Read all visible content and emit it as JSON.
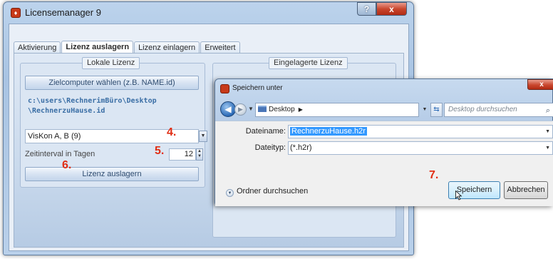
{
  "main_window": {
    "title": "Licensemanager 9",
    "help_button": "?",
    "close_button": "x",
    "tabs": [
      {
        "label": "Aktivierung",
        "active": false
      },
      {
        "label": "Lizenz auslagern",
        "active": true
      },
      {
        "label": "Lizenz einlagern",
        "active": false
      },
      {
        "label": "Erweitert",
        "active": false
      }
    ],
    "local_group": {
      "title": "Lokale Lizenz",
      "choose_computer_button": "Zielcomputer wählen (z.B. NAME.id)",
      "path_line1": "c:\\users\\RechnerimBüro\\Desktop",
      "path_line2": "\\RechnerzuHause.id",
      "license_select_value": "VisKon A, B (9)",
      "interval_label": "Zeitinterval in Tagen",
      "interval_value": "12",
      "export_button": "Lizenz auslagern"
    },
    "remote_group": {
      "title": "Eingelagerte Lizenz"
    }
  },
  "save_dialog": {
    "title": "Speichern unter",
    "close_button": "x",
    "breadcrumb": [
      "Desktop"
    ],
    "search_placeholder": "Desktop durchsuchen",
    "filename_label": "Dateiname:",
    "filename_value": "RechnerzuHause.h2r",
    "filetype_label": "Dateityp:",
    "filetype_value": "(*.h2r)",
    "browse_folders": "Ordner durchsuchen",
    "save_button": "Speichern",
    "cancel_button": "Abbrechen"
  },
  "step_markers": [
    "4.",
    "5.",
    "6.",
    "7."
  ],
  "colors": {
    "step_marker": "#e12e14",
    "path_text": "#3a6ea5",
    "selection": "#3399ff",
    "close_button": "#c9472e"
  }
}
